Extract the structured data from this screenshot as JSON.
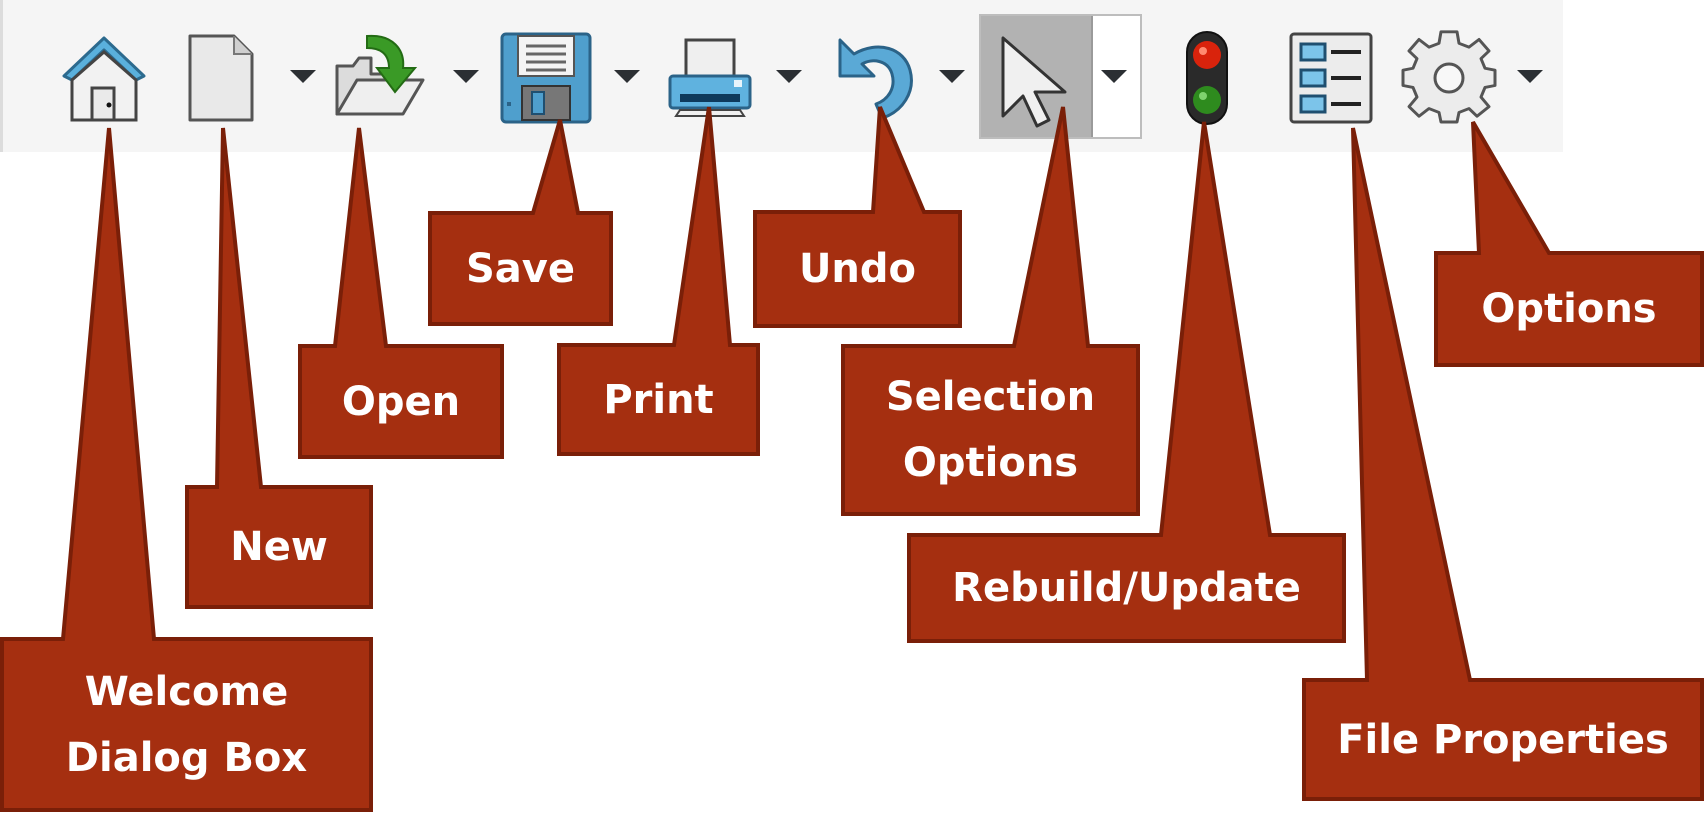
{
  "toolbar": {
    "buttons": [
      {
        "id": "home",
        "icon": "home-icon",
        "has_dropdown": false
      },
      {
        "id": "new",
        "icon": "new-document-icon",
        "has_dropdown": true
      },
      {
        "id": "open",
        "icon": "open-folder-icon",
        "has_dropdown": true
      },
      {
        "id": "save",
        "icon": "floppy-disk-icon",
        "has_dropdown": true
      },
      {
        "id": "print",
        "icon": "printer-icon",
        "has_dropdown": true
      },
      {
        "id": "undo",
        "icon": "undo-arrow-icon",
        "has_dropdown": true
      },
      {
        "id": "select",
        "icon": "cursor-arrow-icon",
        "has_dropdown": true,
        "active": true
      },
      {
        "id": "rebuild",
        "icon": "traffic-light-icon",
        "has_dropdown": false
      },
      {
        "id": "file_properties",
        "icon": "properties-list-icon",
        "has_dropdown": false
      },
      {
        "id": "options",
        "icon": "gear-icon",
        "has_dropdown": true
      }
    ]
  },
  "callouts": {
    "welcome": "Welcome\nDialog Box",
    "new": "New",
    "open": "Open",
    "save": "Save",
    "print": "Print",
    "undo": "Undo",
    "selection": "Selection\nOptions",
    "rebuild": "Rebuild/Update",
    "file_properties": "File Properties",
    "options": "Options"
  },
  "colors": {
    "callout_fill": "#a52f10",
    "callout_border": "#7a1f08",
    "callout_text": "#ffffff",
    "toolbar_bg": "#f5f5f5",
    "icon_blue": "#4a9cc9",
    "icon_green": "#2e8b1e"
  }
}
